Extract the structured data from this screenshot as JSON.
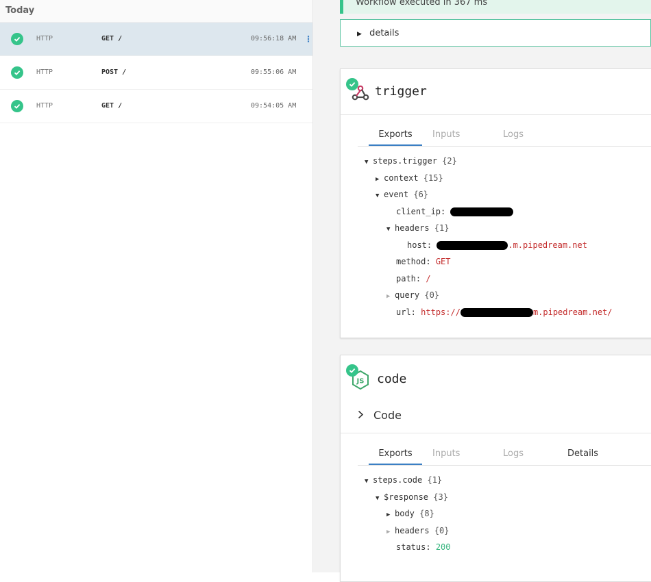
{
  "events": {
    "group_label": "Today",
    "rows": [
      {
        "source": "HTTP",
        "method": "GET /",
        "time": "09:56:18 AM",
        "selected": true
      },
      {
        "source": "HTTP",
        "method": "POST /",
        "time": "09:55:06 AM",
        "selected": false
      },
      {
        "source": "HTTP",
        "method": "GET /",
        "time": "09:54:05 AM",
        "selected": false
      }
    ]
  },
  "workflow": {
    "banner": "Workflow executed in 367 ms",
    "details_label": "details"
  },
  "trigger_step": {
    "title": "trigger",
    "tabs": [
      "Exports",
      "Inputs",
      "Logs"
    ],
    "tree": {
      "root": "steps.trigger",
      "root_count": "{2}",
      "context": "context",
      "context_count": "{15}",
      "event": "event",
      "event_count": "{6}",
      "client_ip_key": "client_ip:",
      "headers": "headers",
      "headers_count": "{1}",
      "host_key": "host:",
      "host_value_tail": ".m.pipedream.net",
      "method_key": "method:",
      "method_value": "GET",
      "path_key": "path:",
      "path_value": "/",
      "query": "query",
      "query_count": "{0}",
      "url_key": "url:",
      "url_value_head": "https://",
      "url_value_tail": "m.pipedream.net/"
    }
  },
  "code_step": {
    "title": "code",
    "section_label": "Code",
    "icon_text": "JS",
    "tabs": [
      "Exports",
      "Inputs",
      "Logs",
      "Details"
    ],
    "tree": {
      "root": "steps.code",
      "root_count": "{1}",
      "response": "$response",
      "response_count": "{3}",
      "body": "body",
      "body_count": "{8}",
      "headers": "headers",
      "headers_count": "{0}",
      "status_key": "status:",
      "status_value": "200"
    }
  },
  "colors": {
    "success": "#35c48a",
    "accent": "#3b7fc4",
    "value_red": "#c42e2e",
    "value_green": "#35b57e"
  }
}
